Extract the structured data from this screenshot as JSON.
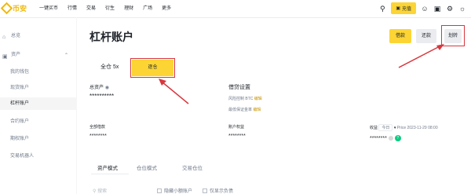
{
  "brand": {
    "name": "币安"
  },
  "nav": [
    "一键买币",
    "行情",
    "交易",
    "衍生",
    "理财",
    "广场",
    "更多"
  ],
  "top_right": {
    "deposit_label": "充值"
  },
  "sidebar": {
    "overview": "总览",
    "assets": "资产",
    "items": [
      "我的钱包",
      "现货账户",
      "杠杆账户",
      "合约账户",
      "期权账户",
      "交易机器人"
    ]
  },
  "header": {
    "title": "杠杆账户",
    "deposit": "借款",
    "transfer": "还款",
    "borrow": "划转"
  },
  "tabs": {
    "all": "全仓 5x",
    "isolated": "逐仓"
  },
  "total_assets": {
    "label": "总资产",
    "value": "**********"
  },
  "risk": {
    "label": "借贷设置",
    "line1_label": "风险控制 BTC",
    "line1_link": "编辑",
    "line2_label": "最低保证金率",
    "line2_link": "编辑"
  },
  "row2": {
    "left_label": "全部借款",
    "left_value": "********",
    "mid_label": "账户权益",
    "mid_value": "********",
    "right_label": "收益",
    "right_pill": "今日",
    "right_note": "Price 2023-11-29 08:00",
    "right_value": "********"
  },
  "bottom_tabs": {
    "a": "资产模式",
    "b": "仓位模式",
    "c": "交易仓位"
  },
  "filters": {
    "search": "搜索",
    "hide_small": "隐藏小额账户",
    "only_debt": "仅显示负债"
  },
  "colors": {
    "accent": "#fcd535",
    "highlight": "#d9363e"
  }
}
